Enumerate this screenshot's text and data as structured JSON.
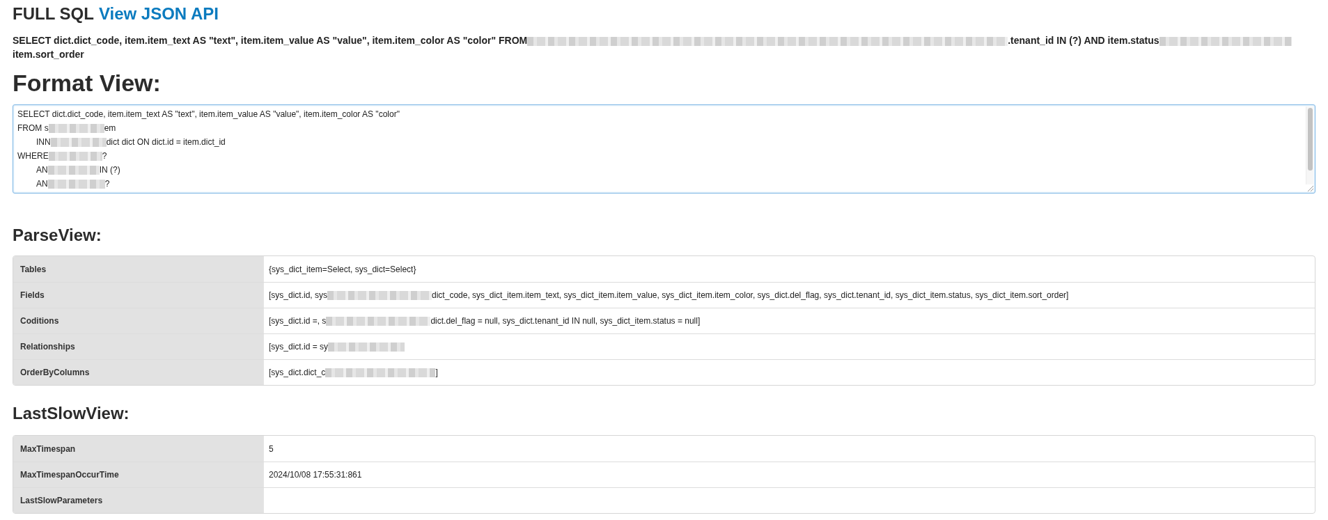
{
  "header": {
    "title": "FULL SQL",
    "link": "View JSON API"
  },
  "full_sql": [
    {
      "kind": "text",
      "text": "SELECT dict.dict_code, item.item_text AS \"text\", item.item_value AS \"value\", item.item_color AS \"color\" FROM"
    },
    {
      "kind": "redacted"
    },
    {
      "kind": "text",
      "text": ".tenant_id IN (?) AND item.status"
    },
    {
      "kind": "redacted"
    },
    {
      "kind": "text",
      "text": "item.sort_order"
    }
  ],
  "format_view": {
    "heading": "Format View:",
    "lines": [
      {
        "parts": [
          {
            "kind": "text",
            "text": "SELECT dict.dict_code, item.item_text AS \"text\", item.item_value AS \"value\", item.item_color AS \"color\""
          }
        ]
      },
      {
        "parts": [
          {
            "kind": "text",
            "text": "FROM s"
          },
          {
            "kind": "redacted"
          },
          {
            "kind": "text",
            "text": "em"
          }
        ],
        "children": [
          {
            "parts": [
              {
                "kind": "text",
                "text": "INN"
              },
              {
                "kind": "redacted"
              },
              {
                "kind": "text",
                "text": "dict dict ON dict.id = item.dict_id"
              }
            ]
          }
        ]
      },
      {
        "parts": [
          {
            "kind": "text",
            "text": "WHERE"
          },
          {
            "kind": "redacted"
          },
          {
            "kind": "text",
            "text": "?"
          }
        ],
        "children": [
          {
            "parts": [
              {
                "kind": "text",
                "text": "AN"
              },
              {
                "kind": "redacted"
              },
              {
                "kind": "text",
                "text": "IN (?)"
              }
            ]
          },
          {
            "parts": [
              {
                "kind": "text",
                "text": "AN"
              },
              {
                "kind": "redacted"
              },
              {
                "kind": "text",
                "text": "?"
              }
            ]
          }
        ]
      }
    ]
  },
  "parse_view": {
    "heading": "ParseView:",
    "rows": [
      {
        "label": "Tables",
        "value": [
          {
            "kind": "text",
            "text": "{sys_dict_item=Select, sys_dict=Select}"
          }
        ]
      },
      {
        "label": "Fields",
        "value": [
          {
            "kind": "text",
            "text": "[sys_dict.id, sys"
          },
          {
            "kind": "redacted"
          },
          {
            "kind": "text",
            "text": "dict_code, sys_dict_item.item_text, sys_dict_item.item_value, sys_dict_item.item_color, sys_dict.del_flag, sys_dict.tenant_id, sys_dict_item.status, sys_dict_item.sort_order]"
          }
        ]
      },
      {
        "label": "Coditions",
        "value": [
          {
            "kind": "text",
            "text": "[sys_dict.id =, s"
          },
          {
            "kind": "redacted"
          },
          {
            "kind": "text",
            "text": "dict.del_flag = null, sys_dict.tenant_id IN null, sys_dict_item.status = null]"
          }
        ]
      },
      {
        "label": "Relationships",
        "value": [
          {
            "kind": "text",
            "text": "[sys_dict.id = sy"
          },
          {
            "kind": "redacted"
          }
        ]
      },
      {
        "label": "OrderByColumns",
        "value": [
          {
            "kind": "text",
            "text": "[sys_dict.dict_c"
          },
          {
            "kind": "redacted"
          },
          {
            "kind": "text",
            "text": "]"
          }
        ]
      }
    ]
  },
  "last_slow_view": {
    "heading": "LastSlowView:",
    "rows": [
      {
        "label": "MaxTimespan",
        "value": [
          {
            "kind": "text",
            "text": "5"
          }
        ]
      },
      {
        "label": "MaxTimespanOccurTime",
        "value": [
          {
            "kind": "text",
            "text": "2024/10/08 17:55:31:861"
          }
        ]
      },
      {
        "label": "LastSlowParameters"
      }
    ]
  }
}
